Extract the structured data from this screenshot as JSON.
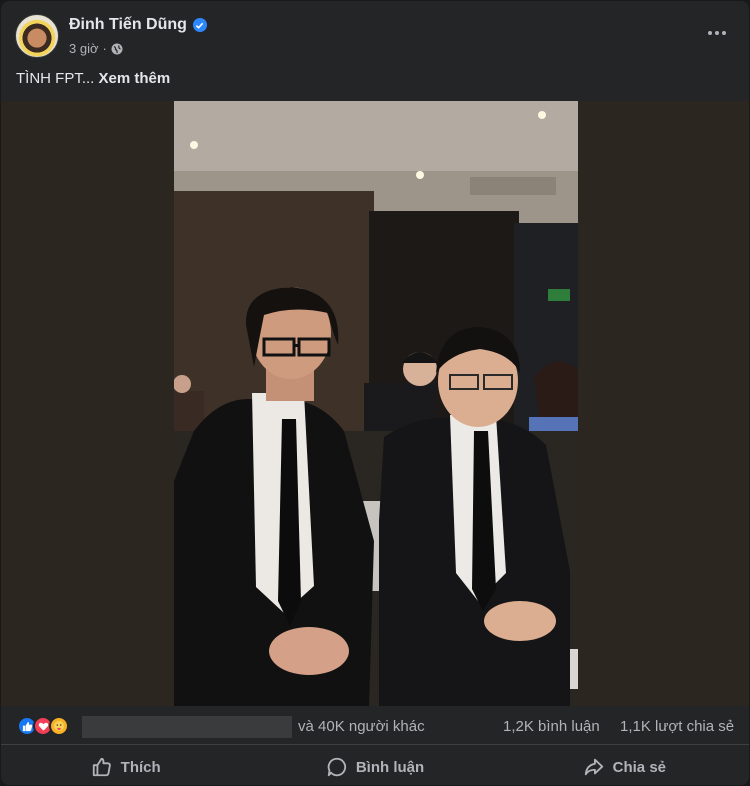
{
  "post": {
    "author": "Đinh Tiến Dũng",
    "time": "3 giờ",
    "separator": "·",
    "caption": "TÌNH FPT...",
    "see_more": "Xem thêm"
  },
  "reactions": {
    "icons": [
      "like-icon",
      "love-icon",
      "care-icon"
    ],
    "others_text": "và 40K người khác",
    "comments_text": "1,2K bình luận",
    "shares_text": "1,1K lượt chia sẻ"
  },
  "actions": {
    "like": "Thích",
    "comment": "Bình luận",
    "share": "Chia sẻ"
  },
  "colors": {
    "background": "#242526",
    "text_primary": "#e4e6eb",
    "text_secondary": "#b0b3b8",
    "verified": "#2d88ff"
  }
}
